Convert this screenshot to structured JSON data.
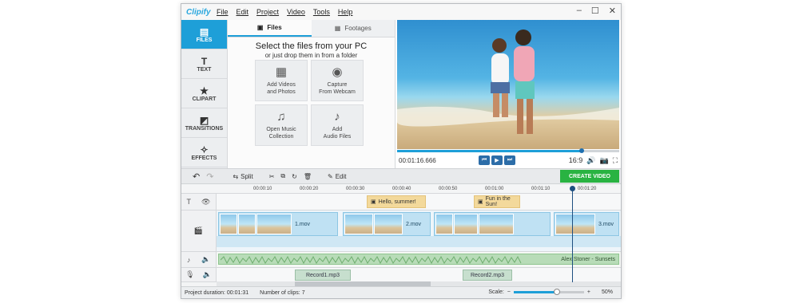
{
  "app": {
    "logo": "Clipify",
    "menu": [
      "File",
      "Edit",
      "Project",
      "Video",
      "Tools",
      "Help"
    ],
    "window_controls": [
      "–",
      "☐",
      "✕"
    ]
  },
  "left_tabs": [
    {
      "label": "FILES",
      "icon": "files-icon",
      "glyph": "▤",
      "active": true
    },
    {
      "label": "TEXT",
      "icon": "text-icon",
      "glyph": "T",
      "active": false
    },
    {
      "label": "CLIPART",
      "icon": "star-icon",
      "glyph": "★",
      "active": false
    },
    {
      "label": "TRANSITIONS",
      "icon": "transitions-icon",
      "glyph": "◩",
      "active": false
    },
    {
      "label": "EFFECTS",
      "icon": "magic-wand-icon",
      "glyph": "✧",
      "active": false
    }
  ],
  "files_panel": {
    "tabs": [
      {
        "label": "Files",
        "glyph": "▣"
      },
      {
        "label": "Footages",
        "glyph": "▦"
      }
    ],
    "heading": "Select the files from your PC",
    "subheading": "or just drop them in from a folder",
    "tiles": [
      {
        "line1": "Add Videos",
        "line2": "and Photos",
        "icon": "film-icon",
        "glyph": "▦"
      },
      {
        "line1": "Capture",
        "line2": "From Webcam",
        "icon": "webcam-icon",
        "glyph": "◉"
      },
      {
        "line1": "Open Music",
        "line2": "Collection",
        "icon": "music-notes-icon",
        "glyph": "♫"
      },
      {
        "line1": "Add",
        "line2": "Audio Files",
        "icon": "microphone-icon",
        "glyph": "♪"
      }
    ]
  },
  "preview": {
    "timecode": "00:01:16.666",
    "progress": 0.83,
    "aspect": "16:9",
    "controls": [
      "⏮",
      "▶",
      "⏭"
    ],
    "tools": [
      "🔊",
      "📷",
      "⛶"
    ]
  },
  "toolbar": {
    "undo": "↶",
    "redo": "↷",
    "split": "Split",
    "edit": "Edit",
    "icons": [
      "✂",
      "⧉",
      "↻",
      "🗑"
    ],
    "create_video": "CREATE VIDEO"
  },
  "timeline": {
    "ruler": [
      "00:00:10",
      "00:00:20",
      "00:00:30",
      "00:00:40",
      "00:00:50",
      "00:01:00",
      "00:01:10",
      "00:01:20"
    ],
    "text_clips": [
      "Hello, summer!",
      "Fun in the Sun!"
    ],
    "video_clips": [
      "1.mov",
      "2.mov",
      "3.mov"
    ],
    "audio_clip": "Alex Stoner - Sunsets",
    "records": [
      "Record1.mp3",
      "Record2.mp3"
    ],
    "row_icons": {
      "text": [
        "T",
        "👁"
      ],
      "video": [
        "🎬"
      ],
      "audio": [
        "♪",
        "🔈"
      ],
      "voice": [
        "🎙",
        "🔈"
      ]
    }
  },
  "status": {
    "duration": "Project duration:  00:01:31",
    "clips": "Number of clips: 7",
    "scale_label": "Scale:",
    "zoom_out": "−",
    "zoom_in": "+",
    "zoom": "50%",
    "zoom_value": 0.62
  }
}
